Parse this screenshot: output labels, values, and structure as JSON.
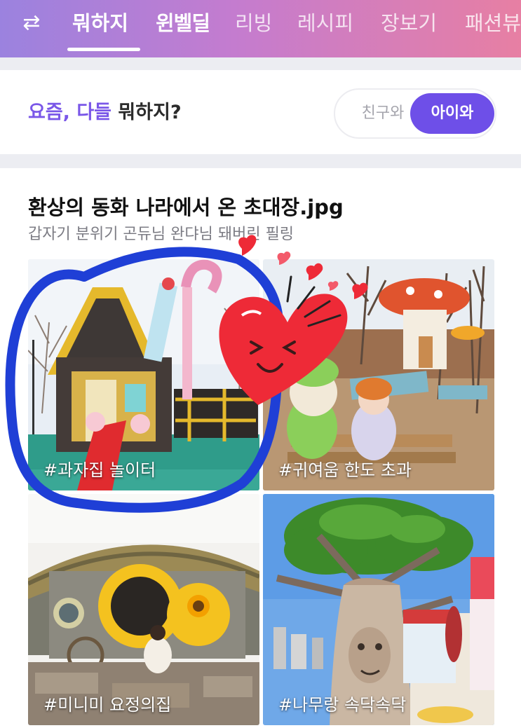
{
  "nav": {
    "swap_icon": "swap-arrows-icon",
    "tabs": [
      {
        "label": "뭐하지"
      },
      {
        "label": "윈벨딜"
      },
      {
        "label": "리빙"
      },
      {
        "label": "레시피"
      },
      {
        "label": "장보기"
      },
      {
        "label": "패션뷰"
      }
    ]
  },
  "headline": {
    "part1": "요즘, 다들",
    "part2": " 뭐하지?"
  },
  "toggle": {
    "friends": "친구와",
    "kids": "아이와"
  },
  "post": {
    "title": "환상의 동화 나라에서 온 초대장.jpg",
    "subtitle": "갑자기 분위기 곤듀님 완댜님 돼버린 필링"
  },
  "tiles": [
    {
      "label": "#과자집 놀이터"
    },
    {
      "label": "#귀여움 한도 초과"
    },
    {
      "label": "#미니미 요정의집"
    },
    {
      "label": "#나무랑 속닥속닥"
    }
  ],
  "colors": {
    "accent": "#6e4fe8",
    "highlight_text": "#7a57e8",
    "circle_marker": "#1f3fd6",
    "heart": "#ee2a37"
  }
}
